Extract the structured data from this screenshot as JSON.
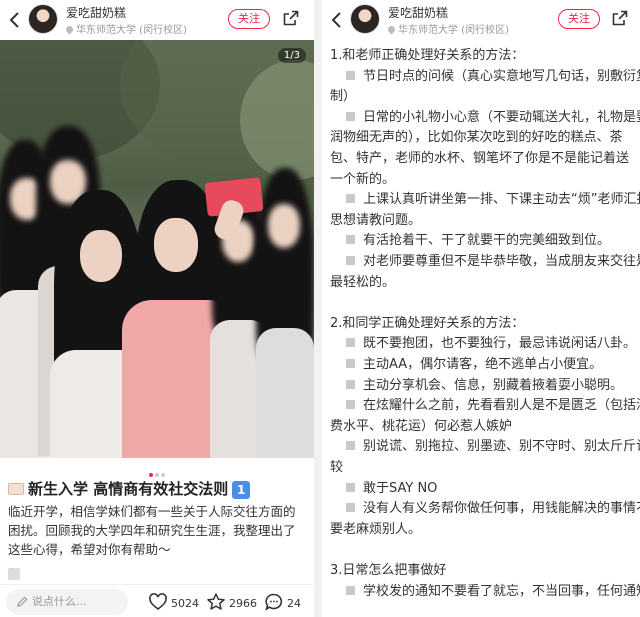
{
  "left": {
    "header": {
      "username": "爱吃甜奶糕",
      "location": "华东师范大学 (闵行校区)",
      "follow_label": "关注"
    },
    "image_counter": "1/3",
    "title": "新生入学 高情商有效社交法则",
    "title_number": "1",
    "body_lines": [
      "临近开学，相信学妹们都有一些关于人际交往方面的",
      "困扰。回顾我的大学四年和研究生生涯，我整理出了",
      "这些心得，希望对你有帮助～"
    ],
    "bottom_bar": {
      "comment_placeholder": "说点什么...",
      "likes": "5024",
      "favorites": "2966",
      "comments": "24"
    }
  },
  "right": {
    "header": {
      "username": "爱吃甜奶糕",
      "location": "华东师范大学 (闵行校区)",
      "follow_label": "关注"
    },
    "lines": [
      {
        "text": "1.和老师正确处理好关系的方法：",
        "bullet": false
      },
      {
        "text": "节日时点的问候（真心实意地写几句话，别敷衍复",
        "bullet": true
      },
      {
        "text": "制）",
        "bullet": false
      },
      {
        "text": "日常的小礼物小心意（不要动辄送大礼，礼物是要",
        "bullet": true
      },
      {
        "text": "润物细无声的），比如你某次吃到的好吃的糕点、茶",
        "bullet": false
      },
      {
        "text": "包、特产，老师的水杯、钢笔坏了你是不是能记着送",
        "bullet": false
      },
      {
        "text": "一个新的。",
        "bullet": false
      },
      {
        "text": "上课认真听讲坐第一排、下课主动去“烦”老师汇报",
        "bullet": true
      },
      {
        "text": "思想请教问题。",
        "bullet": false
      },
      {
        "text": "有活抢着干、干了就要干的完美细致到位。",
        "bullet": true
      },
      {
        "text": "对老师要尊重但不是毕恭毕敬，当成朋友来交往是",
        "bullet": true
      },
      {
        "text": "最轻松的。",
        "bullet": false
      },
      {
        "text": "",
        "bullet": false
      },
      {
        "text": "2.和同学正确处理好关系的方法：",
        "bullet": false
      },
      {
        "text": "既不要抱团，也不要独行，最忌讳说闲话八卦。",
        "bullet": true
      },
      {
        "text": "主动AA，偶尔请客，绝不逃单占小便宜。",
        "bullet": true
      },
      {
        "text": "主动分享机会、信息，别藏着掖着耍小聪明。",
        "bullet": true
      },
      {
        "text": "在炫耀什么之前，先看看别人是不是匮乏（包括消",
        "bullet": true
      },
      {
        "text": "费水平、桃花运）何必惹人嫉妒",
        "bullet": false
      },
      {
        "text": "别说谎、别拖拉、别墨迹、别不守时、别太斤斤计",
        "bullet": true
      },
      {
        "text": "较",
        "bullet": false
      },
      {
        "text": "敢于SAY NO",
        "bullet": true
      },
      {
        "text": "没有人有义务帮你做任何事，用钱能解决的事情不",
        "bullet": true
      },
      {
        "text": "要老麻烦别人。",
        "bullet": false
      },
      {
        "text": "",
        "bullet": false
      },
      {
        "text": "3.日常怎么把事做好",
        "bullet": false
      },
      {
        "text": "学校发的通知不要看了就忘，不当回事，任何通知",
        "bullet": true
      }
    ]
  },
  "colors": {
    "accent": "#ff2442",
    "bullet": "#c9c9c9",
    "number_badge": "#4a8fe7"
  },
  "icons": [
    "back-arrow-icon",
    "location-pin-icon",
    "share-icon",
    "pen-icon",
    "heart-icon",
    "star-icon",
    "comment-icon"
  ]
}
